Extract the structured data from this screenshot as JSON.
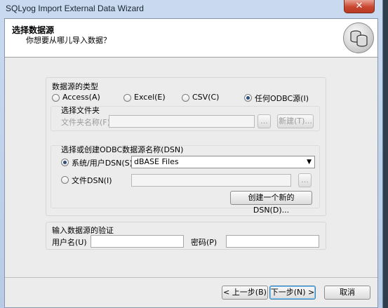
{
  "window": {
    "title": "SQLyog Import External Data Wizard",
    "close_glyph": "✕",
    "header_title": "选择数据源",
    "header_subtitle": "你想要从哪儿导入数据？",
    "header_icon": "database-icon"
  },
  "source_type": {
    "label": "数据源的类型",
    "options": [
      {
        "label": "Access(A)",
        "selected": false
      },
      {
        "label": "Excel(E)",
        "selected": false
      },
      {
        "label": "CSV(C)",
        "selected": false
      },
      {
        "label": "任何ODBC源(I)",
        "selected": true
      }
    ]
  },
  "folder": {
    "group_label": "选择文件夹",
    "name_label": "文件夹名称(F)",
    "name_value": "",
    "browse_label": "...",
    "new_label": "新建(T)..."
  },
  "dsn": {
    "group_label": "选择或创建ODBC数据源名称(DSN)",
    "system_label": "系统/用户DSN(S)",
    "system_value": "dBASE Files",
    "file_label": "文件DSN(I)",
    "file_value": "",
    "browse_label": "...",
    "create_label": "创建一个新的DSN(D)..."
  },
  "auth": {
    "label": "输入数据源的验证",
    "username_label": "用户名(U)",
    "username_value": "",
    "password_label": "密码(P)",
    "password_value": ""
  },
  "footer": {
    "back_label": "< 上一步(B)",
    "next_label": "下一步(N) >",
    "cancel_label": "取消"
  }
}
